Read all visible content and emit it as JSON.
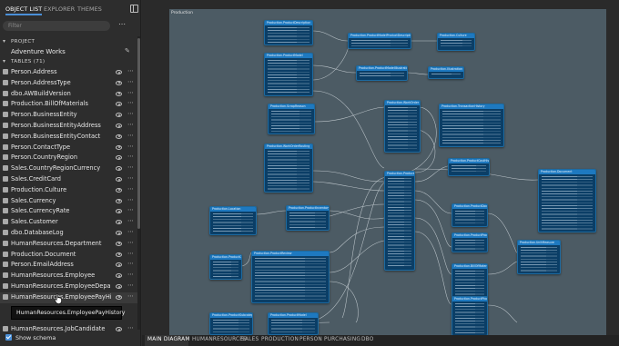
{
  "sidebar": {
    "tabs": [
      "OBJECT LIST",
      "EXPLORER",
      "THEMES"
    ],
    "active_tab": "OBJECT LIST",
    "filter_placeholder": "Filter",
    "project_section": "PROJECT",
    "project_name": "Adventure Works",
    "tables_section": "TABLES",
    "tables_count": "(71)",
    "tables": [
      "Person.Address",
      "Person.AddressType",
      "dbo.AWBuildVersion",
      "Production.BillOfMaterials",
      "Person.BusinessEntity",
      "Person.BusinessEntityAddress",
      "Person.BusinessEntityContact",
      "Person.ContactType",
      "Person.CountryRegion",
      "Sales.CountryRegionCurrency",
      "Sales.CreditCard",
      "Production.Culture",
      "Sales.Currency",
      "Sales.CurrencyRate",
      "Sales.Customer",
      "dbo.DatabaseLog",
      "HumanResources.Department",
      "Production.Document",
      "Person.EmailAddress",
      "HumanResources.Employee",
      "HumanResources.EmployeeDepar...",
      "HumanResources.EmployeePayHi...",
      "",
      "",
      "HumanResources.JobCandidate"
    ],
    "tooltip": "HumanResources.EmployeePayHistory",
    "show_schema_label": "Show schema",
    "show_schema_checked": true
  },
  "diagram": {
    "label": "Production",
    "entities": [
      "Production.ProductDescription",
      "Production.ProductModelProductDescriptionCulture",
      "Production.Culture",
      "Production.ProductModel",
      "Production.ProductModelIllustration",
      "Production.Illustration",
      "Production.WorkOrder",
      "Production.TransactionHistory",
      "Production.ScrapReason",
      "Production.WorkOrderRouting",
      "Production.ProductCostHistory",
      "Production.Product",
      "Production.ProductListPriceHistory",
      "Production.Document",
      "Production.Location",
      "Production.ProductInventory",
      "Production.ProductDocument",
      "Production.UnitMeasure",
      "Production.BillOfMaterials",
      "Production.ProductProductPhoto",
      "Production.ProductPhoto",
      "Production.ProductReview",
      "Production.ProductCategory",
      "Production.ProductSubcategory",
      "Production.ProductModel"
    ]
  },
  "bottom_tabs": [
    "MAIN DIAGRAM",
    "HUMANRESOURCES",
    "SALES",
    "PRODUCTION",
    "PERSON",
    "PURCHASING",
    "DBO"
  ],
  "active_bottom_tab": "MAIN DIAGRAM",
  "colors": {
    "accent": "#4a90d9",
    "entity_header": "#1e79c0",
    "entity_body": "#0b3e66",
    "diagram_bg": "#4c5b64"
  }
}
